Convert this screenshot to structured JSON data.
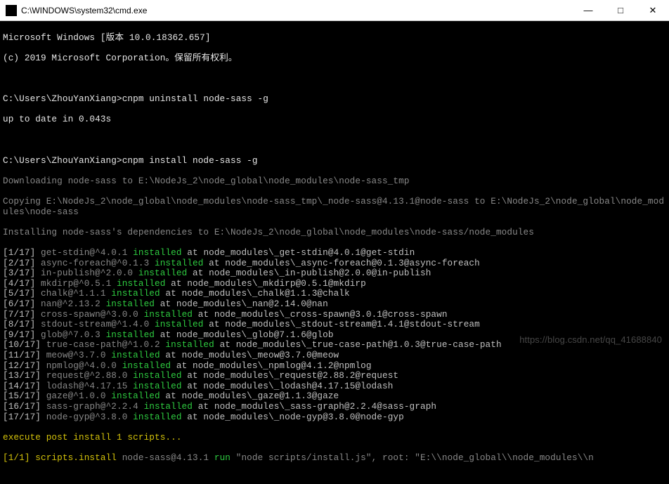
{
  "window": {
    "title": "C:\\WINDOWS\\system32\\cmd.exe",
    "minimize": "—",
    "maximize": "□",
    "close": "✕"
  },
  "header": {
    "version": "Microsoft Windows [版本 10.0.18362.657]",
    "copyright": "(c) 2019 Microsoft Corporation。保留所有权利。"
  },
  "cmd1": {
    "prompt": "C:\\Users\\ZhouYanXiang>",
    "command": "cnpm uninstall node-sass -g",
    "result": "up to date in 0.043s"
  },
  "cmd2": {
    "prompt": "C:\\Users\\ZhouYanXiang>",
    "command": "cnpm install node-sass -g"
  },
  "progress": {
    "downloading": "Downloading node-sass to E:\\NodeJs_2\\node_global\\node_modules\\node-sass_tmp",
    "copying": "Copying E:\\NodeJs_2\\node_global\\node_modules\\node-sass_tmp\\_node-sass@4.13.1@node-sass to E:\\NodeJs_2\\node_global\\node_modules\\node-sass",
    "installing": "Installing node-sass's dependencies to E:\\NodeJs_2\\node_global\\node_modules\\node-sass/node_modules"
  },
  "deps": [
    {
      "idx": "[1/17]",
      "pkg": " get-stdin@^4.0.1 ",
      "word": "installed",
      "rest": " at node_modules\\_get-stdin@4.0.1@get-stdin"
    },
    {
      "idx": "[2/17]",
      "pkg": " async-foreach@^0.1.3 ",
      "word": "installed",
      "rest": " at node_modules\\_async-foreach@0.1.3@async-foreach"
    },
    {
      "idx": "[3/17]",
      "pkg": " in-publish@^2.0.0 ",
      "word": "installed",
      "rest": " at node_modules\\_in-publish@2.0.0@in-publish"
    },
    {
      "idx": "[4/17]",
      "pkg": " mkdirp@^0.5.1 ",
      "word": "installed",
      "rest": " at node_modules\\_mkdirp@0.5.1@mkdirp"
    },
    {
      "idx": "[5/17]",
      "pkg": " chalk@^1.1.1 ",
      "word": "installed",
      "rest": " at node_modules\\_chalk@1.1.3@chalk"
    },
    {
      "idx": "[6/17]",
      "pkg": " nan@^2.13.2 ",
      "word": "installed",
      "rest": " at node_modules\\_nan@2.14.0@nan"
    },
    {
      "idx": "[7/17]",
      "pkg": " cross-spawn@^3.0.0 ",
      "word": "installed",
      "rest": " at node_modules\\_cross-spawn@3.0.1@cross-spawn"
    },
    {
      "idx": "[8/17]",
      "pkg": " stdout-stream@^1.4.0 ",
      "word": "installed",
      "rest": " at node_modules\\_stdout-stream@1.4.1@stdout-stream"
    },
    {
      "idx": "[9/17]",
      "pkg": " glob@^7.0.3 ",
      "word": "installed",
      "rest": " at node_modules\\_glob@7.1.6@glob"
    },
    {
      "idx": "[10/17]",
      "pkg": " true-case-path@^1.0.2 ",
      "word": "installed",
      "rest": " at node_modules\\_true-case-path@1.0.3@true-case-path"
    },
    {
      "idx": "[11/17]",
      "pkg": " meow@^3.7.0 ",
      "word": "installed",
      "rest": " at node_modules\\_meow@3.7.0@meow"
    },
    {
      "idx": "[12/17]",
      "pkg": " npmlog@^4.0.0 ",
      "word": "installed",
      "rest": " at node_modules\\_npmlog@4.1.2@npmlog"
    },
    {
      "idx": "[13/17]",
      "pkg": " request@^2.88.0 ",
      "word": "installed",
      "rest": " at node_modules\\_request@2.88.2@request"
    },
    {
      "idx": "[14/17]",
      "pkg": " lodash@^4.17.15 ",
      "word": "installed",
      "rest": " at node_modules\\_lodash@4.17.15@lodash"
    },
    {
      "idx": "[15/17]",
      "pkg": " gaze@^1.0.0 ",
      "word": "installed",
      "rest": " at node_modules\\_gaze@1.1.3@gaze"
    },
    {
      "idx": "[16/17]",
      "pkg": " sass-graph@^2.2.4 ",
      "word": "installed",
      "rest": " at node_modules\\_sass-graph@2.2.4@sass-graph"
    },
    {
      "idx": "[17/17]",
      "pkg": " node-gyp@^3.8.0 ",
      "word": "installed",
      "rest": " at node_modules\\_node-gyp@3.8.0@node-gyp"
    }
  ],
  "post": {
    "exec": "execute post install 1 scripts...",
    "script_idx": "[1/1]",
    "script_name": " scripts.install ",
    "script_pkg": "node-sass@4.13.1 ",
    "script_run": "run",
    "script_rest": " \"node scripts/install.js\", root: \"E:\\\\node_global\\\\node_modules\\\\n"
  },
  "watermark": "https://blog.csdn.net/qq_41688840"
}
